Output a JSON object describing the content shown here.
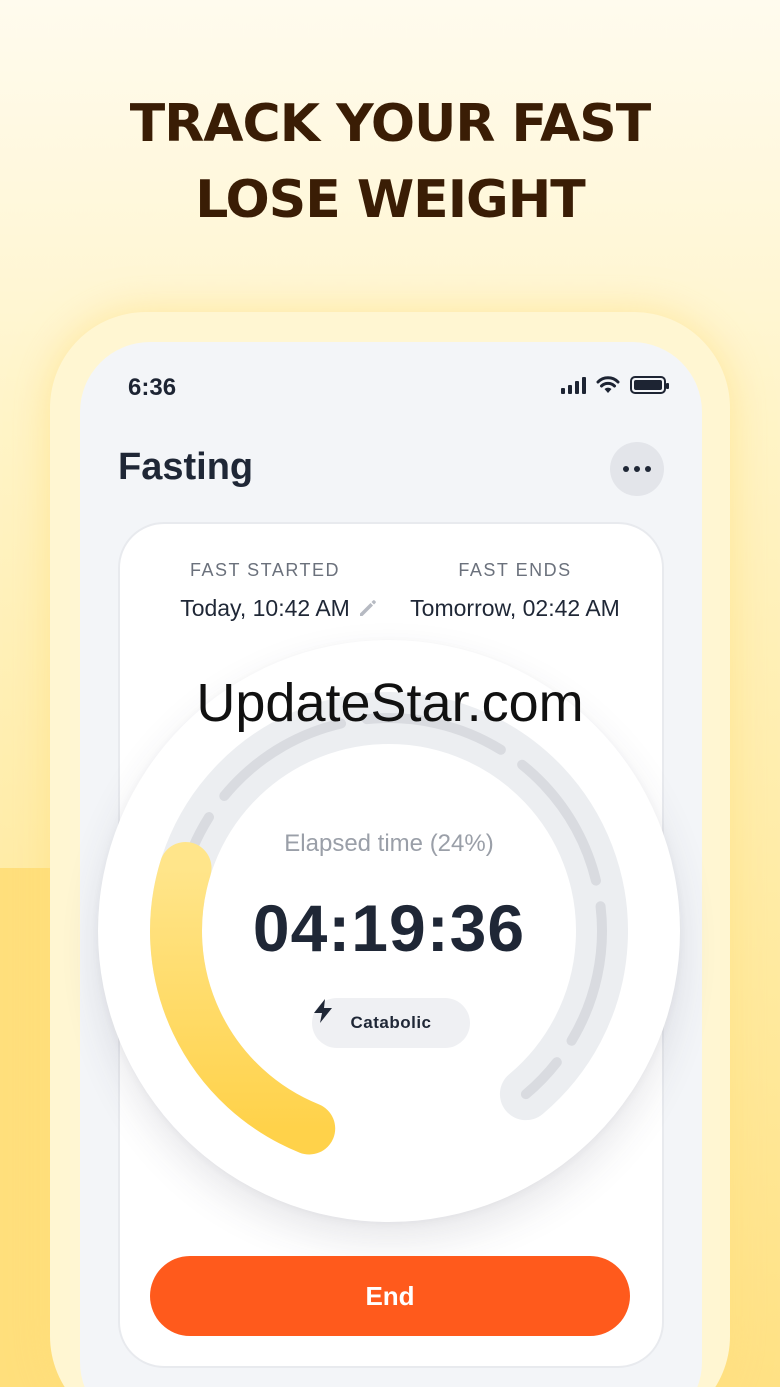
{
  "headline": {
    "line1": "TRACK YOUR FAST",
    "line2": "LOSE WEIGHT"
  },
  "status_bar": {
    "time": "6:36",
    "icons": [
      "signal-icon",
      "wifi-icon",
      "battery-icon"
    ]
  },
  "header": {
    "title": "Fasting",
    "more_icon": "more-horizontal-icon"
  },
  "fast": {
    "started_label": "FAST STARTED",
    "started_value": "Today, 10:42 AM",
    "ends_label": "FAST ENDS",
    "ends_value": "Tomorrow, 02:42 AM",
    "edit_icon": "pencil-icon"
  },
  "timer": {
    "elapsed_label": "Elapsed time (24%)",
    "elapsed_time": "04:19:36",
    "progress_fraction": 0.24,
    "stage_label": "Catabolic",
    "stage_icon": "lightning-icon"
  },
  "watermark": "UpdateStar.com",
  "actions": {
    "end_label": "End"
  },
  "colors": {
    "accent_orange": "#ff5a1c",
    "progress_yellow": "#ffd85a",
    "text_dark": "#1f2736",
    "headline_brown": "#3a1d05"
  }
}
